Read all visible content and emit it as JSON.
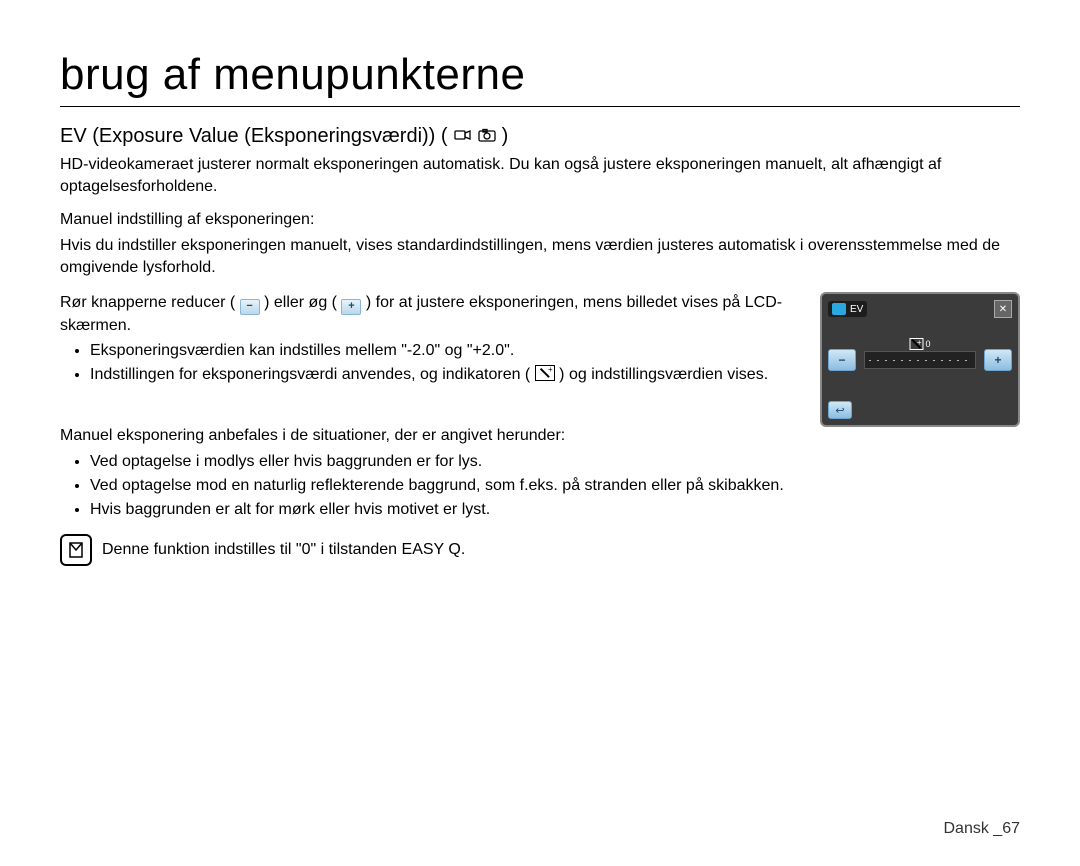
{
  "title": "brug af menupunkterne",
  "section": {
    "heading": "EV (Exposure Value (Eksponeringsværdi)) (",
    "heading_end": ")",
    "intro": "HD-videokameraet justerer normalt eksponeringen automatisk. Du kan også justere eksponeringen manuelt, alt afhængigt af optagelsesforholdene."
  },
  "manual": {
    "heading": "Manuel indstilling af eksponeringen:",
    "p1": "Hvis du indstiller eksponeringen manuelt, vises standardindstillingen, mens værdien justeres automatisk i overensstemmelse med de omgivende lysforhold.",
    "p2_a": "Rør knapperne reducer (",
    "p2_b": ") eller øg (",
    "p2_c": ") for at justere eksponeringen, mens billedet vises på LCD-skærmen.",
    "b1": "Eksponeringsværdien kan indstilles mellem \"-2.0\" og \"+2.0\".",
    "b2_a": "Indstillingen for eksponeringsværdi anvendes, og indikatoren (",
    "b2_b": ") og indstillingsværdien vises."
  },
  "situations": {
    "heading": "Manuel eksponering anbefales i de situationer, der er angivet herunder:",
    "b1": "Ved optagelse i modlys eller hvis baggrunden er for lys.",
    "b2": "Ved optagelse mod en naturlig reflekterende baggrund, som f.eks. på stranden eller på skibakken.",
    "b3": "Hvis baggrunden er alt for mørk eller hvis motivet er lyst."
  },
  "note": "Denne funktion indstilles til \"0\" i tilstanden EASY Q.",
  "lcd": {
    "ev_label": "EV",
    "value": "0",
    "minus": "−",
    "plus": "+",
    "close": "✕",
    "back": "↩"
  },
  "footer": {
    "lang": "Dansk _",
    "page": "67"
  }
}
